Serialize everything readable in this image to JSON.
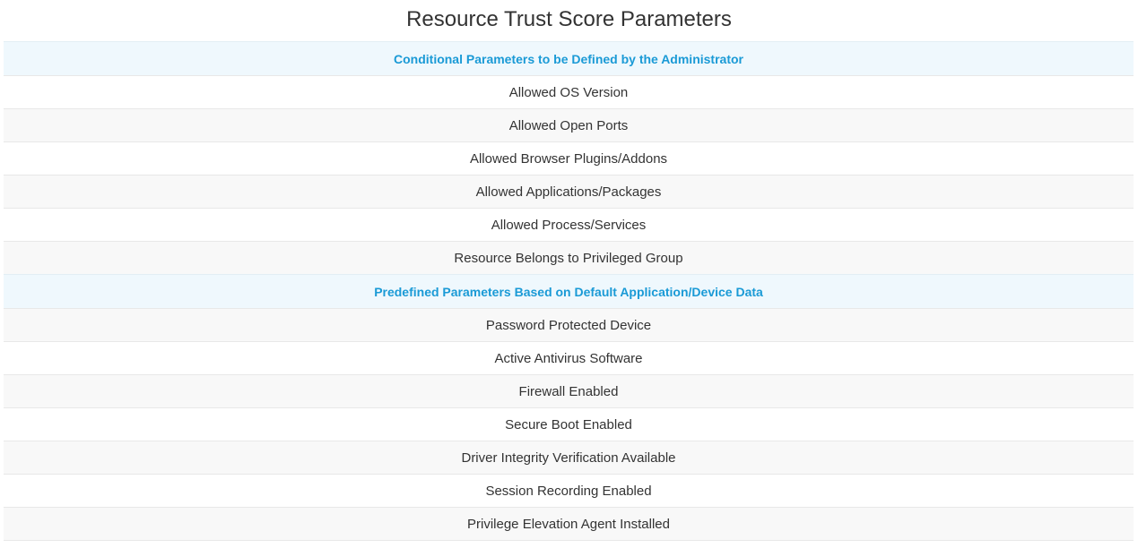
{
  "title": "Resource Trust Score Parameters",
  "sections": [
    {
      "heading": "Conditional Parameters to be Defined by the Administrator",
      "items": [
        "Allowed OS Version",
        "Allowed Open Ports",
        "Allowed Browser Plugins/Addons",
        "Allowed Applications/Packages",
        "Allowed Process/Services",
        "Resource Belongs to Privileged Group"
      ]
    },
    {
      "heading": "Predefined Parameters Based on Default Application/Device Data",
      "items": [
        "Password Protected Device",
        "Active Antivirus Software",
        "Firewall Enabled",
        "Secure Boot Enabled",
        "Driver Integrity Verification Available",
        "Session Recording Enabled",
        "Privilege Elevation Agent Installed"
      ]
    }
  ],
  "colors": {
    "section_background": "#eff8fd",
    "section_text": "#1a9ad6",
    "row_alt_background": "#f8f8f8",
    "text": "#333333"
  }
}
